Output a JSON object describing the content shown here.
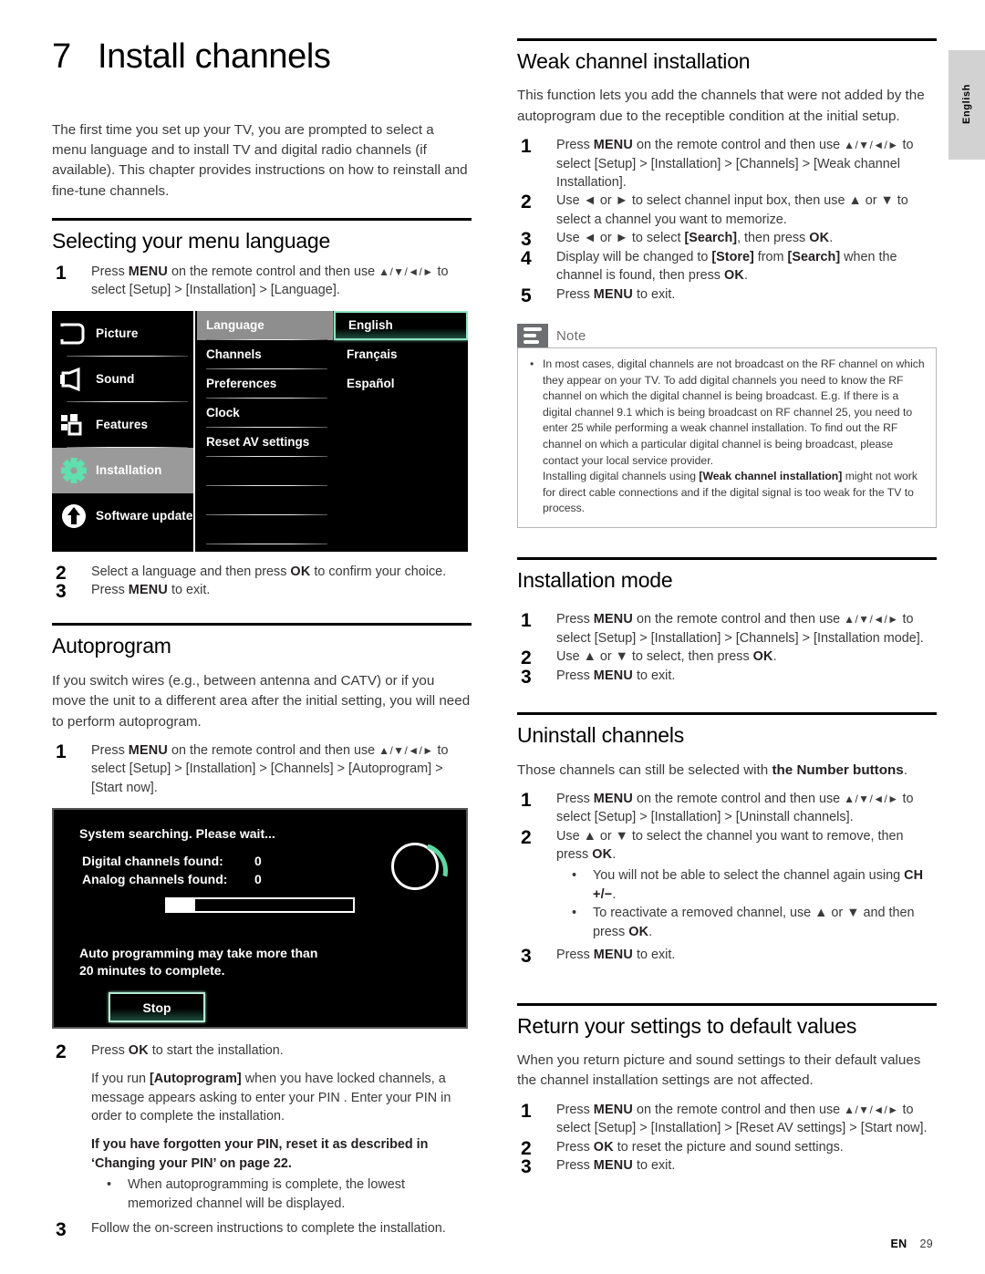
{
  "page": {
    "lang_tab": "English",
    "footer_label": "EN",
    "footer_page": "29"
  },
  "chapter": {
    "number": "7",
    "title": "Install channels",
    "intro": "The first time you set up your TV, you are prompted to select a menu language and to install TV and digital radio channels (if available). This chapter provides instructions on how to reinstall and fine-tune channels."
  },
  "menu_language": {
    "heading": "Selecting your menu language",
    "step1_num": "1",
    "step1_a": "Press ",
    "step1_menu": "MENU",
    "step1_b": " on the remote control and then use ",
    "step1_arrows": "▲/▼/◄/►",
    "step1_c": " to select [Setup] > [Installation] > [Language].",
    "step2_num": "2",
    "step2_a": "Select a language and then press ",
    "step2_ok": "OK",
    "step2_b": " to confirm your choice.",
    "step3_num": "3",
    "step3_a": "Press ",
    "step3_menu": "MENU",
    "step3_b": " to exit."
  },
  "osd_language": {
    "left_items": [
      {
        "label": "Picture",
        "icon": "picture-icon",
        "selected": false
      },
      {
        "label": "Sound",
        "icon": "sound-icon",
        "selected": false
      },
      {
        "label": "Features",
        "icon": "features-icon",
        "selected": false
      },
      {
        "label": "Installation",
        "icon": "gear-icon",
        "selected": true
      },
      {
        "label": "Software update",
        "icon": "upload-arrow-icon",
        "selected": false
      }
    ],
    "mid_items": [
      {
        "label": "Language",
        "highlight": true
      },
      {
        "label": "Channels",
        "highlight": false
      },
      {
        "label": "Preferences",
        "highlight": false
      },
      {
        "label": "Clock",
        "highlight": false
      },
      {
        "label": "Reset AV settings",
        "highlight": false
      }
    ],
    "right_items": [
      {
        "label": "English",
        "selected": true
      },
      {
        "label": "Français",
        "selected": false
      },
      {
        "label": "Español",
        "selected": false
      }
    ],
    "accent_color": "#8fe3c0"
  },
  "autoprogram": {
    "heading": "Autoprogram",
    "para": "If you switch wires (e.g., between antenna and CATV) or if you move the unit to a different area after the initial setting, you will need to perform autoprogram.",
    "step1_num": "1",
    "step1_a": "Press ",
    "step1_menu": "MENU",
    "step1_b": " on the remote control and then use ",
    "step1_arrows": "▲/▼/◄/►",
    "step1_c": " to select [Setup] > [Installation] > [Channels] > [Autoprogram] > [Start now].",
    "step2_num": "2",
    "step2_a": "Press ",
    "step2_ok": "OK",
    "step2_b": " to start the installation.",
    "step2_p2_a": "If you run ",
    "step2_p2_bold": "[Autoprogram]",
    "step2_p2_b": " when you have locked channels, a message appears asking to enter your PIN . Enter your PIN in order to complete the installation.",
    "step2_p3": "If you have forgotten your PIN, reset it as described in ‘Changing your PIN’ on page 22.",
    "step2_bullet": "When autoprogramming is complete, the lowest memorized channel will be displayed.",
    "step3_num": "3",
    "step3_a": "Follow the on-screen instructions to complete the installation."
  },
  "osd_search": {
    "title": "System searching. Please wait...",
    "digital_label": "Digital channels found:",
    "digital_value": "0",
    "analog_label": "Analog channels found:",
    "analog_value": "0",
    "progress_percent": 15,
    "note_line1": "Auto programming may take more than",
    "note_line2": "20 minutes to complete.",
    "stop_button": "Stop",
    "accent_color": "#5fd6a0"
  },
  "weak_channel": {
    "heading": "Weak channel installation",
    "para": "This function lets you add the channels that were not added by the autoprogram due to the receptible condition at the initial setup.",
    "step1_num": "1",
    "step1_a": "Press ",
    "step1_menu": "MENU",
    "step1_b": " on the remote control and then use ",
    "step1_arrows": "▲/▼/◄/►",
    "step1_c": " to select [Setup] > [Installation] > [Channels] > [Weak channel Installation].",
    "step2_num": "2",
    "step2_a": "Use ◄ or ► to select channel input box, then use ▲ or ▼ to select a channel you want to memorize.",
    "step3_num": "3",
    "step3_a": "Use ◄ or ► to select ",
    "step3_bold": "[Search]",
    "step3_b": ", then press ",
    "step3_ok": "OK",
    "step3_c": ".",
    "step4_num": "4",
    "step4_a": "Display will be changed to ",
    "step4_store": "[Store]",
    "step4_b": " from ",
    "step4_search": "[Search]",
    "step4_c": " when the channel is found, then press ",
    "step4_ok": "OK",
    "step4_d": ".",
    "step5_num": "5",
    "step5_a": "Press ",
    "step5_menu": "MENU",
    "step5_b": " to exit."
  },
  "note": {
    "title": "Note",
    "body_a": "In most cases, digital channels are not broadcast on the RF channel on which they appear on your TV. To add digital channels you need to know the RF channel on which the digital channel is being broadcast. E.g. If there is a digital channel 9.1 which is being broadcast on RF channel 25, you need to enter 25 while performing a weak channel installation. To find out the RF channel on which a particular digital channel is being broadcast, please contact your local service provider.",
    "body_b1": "Installing digital channels using ",
    "body_bold": "[Weak channel installation]",
    "body_b2": " might not work for direct cable connections and if the digital signal is too weak for the TV to process."
  },
  "installation_mode": {
    "heading": "Installation mode",
    "step1_num": "1",
    "step1_a": "Press ",
    "step1_menu": "MENU",
    "step1_b": " on the remote control and then use ",
    "step1_arrows": "▲/▼/◄/►",
    "step1_c": " to select [Setup] > [Installation] > [Channels] > [Installation mode].",
    "step2_num": "2",
    "step2_a": "Use ▲ or ▼ to select, then press ",
    "step2_ok": "OK",
    "step2_b": ".",
    "step3_num": "3",
    "step3_a": "Press ",
    "step3_menu": "MENU",
    "step3_b": " to exit."
  },
  "uninstall": {
    "heading": "Uninstall channels",
    "para_a": "Those channels can still be selected with ",
    "para_bold": "the Number buttons",
    "para_b": ".",
    "step1_num": "1",
    "step1_a": "Press ",
    "step1_menu": "MENU",
    "step1_b": " on the remote control and then use ",
    "step1_arrows": "▲/▼/◄/►",
    "step1_c": " to select [Setup] > [Installation] > [Uninstall channels].",
    "step2_num": "2",
    "step2_a": "Use ▲ or ▼ to select the channel you want to remove, then press ",
    "step2_ok": "OK",
    "step2_b": ".",
    "bullet1_a": "You will not be able to select the channel again using ",
    "bullet1_caps": "CH +/−",
    "bullet1_b": ".",
    "bullet2_a": "To reactivate a removed channel, use ▲ or ▼ and then press ",
    "bullet2_ok": "OK",
    "bullet2_b": ".",
    "step3_num": "3",
    "step3_a": "Press ",
    "step3_menu": "MENU",
    "step3_b": " to exit."
  },
  "reset_defaults": {
    "heading": "Return your settings to default values",
    "para": "When you return picture and sound settings to their default values the channel installation settings are not affected.",
    "step1_num": "1",
    "step1_a": "Press ",
    "step1_menu": "MENU",
    "step1_b": " on the remote control and then use ",
    "step1_arrows": "▲/▼/◄/►",
    "step1_c": " to select [Setup] > [Installation] > [Reset AV settings] > [Start now].",
    "step2_num": "2",
    "step2_a": "Press ",
    "step2_ok": "OK",
    "step2_b": " to reset the picture and sound settings.",
    "step3_num": "3",
    "step3_a": "Press ",
    "step3_menu": "MENU",
    "step3_b": " to exit."
  }
}
